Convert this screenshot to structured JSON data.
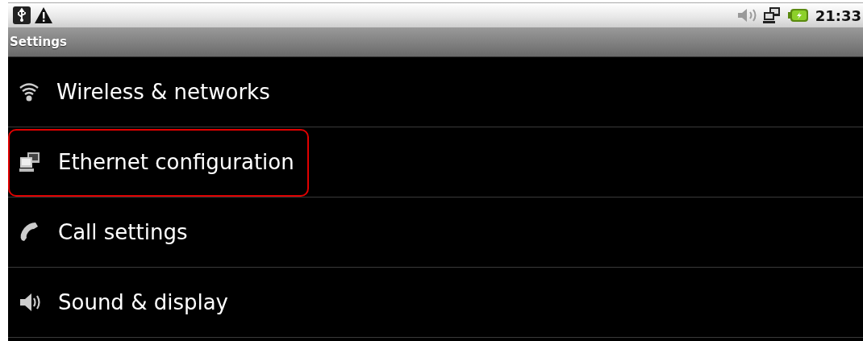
{
  "status_bar": {
    "time": "21:33"
  },
  "title_bar": {
    "title": "Settings"
  },
  "items": [
    {
      "label": "Wireless & networks",
      "kind": "wifi",
      "highlighted": false
    },
    {
      "label": "Ethernet configuration",
      "kind": "ethernet",
      "highlighted": true
    },
    {
      "label": "Call settings",
      "kind": "phone",
      "highlighted": false
    },
    {
      "label": "Sound & display",
      "kind": "speaker",
      "highlighted": false
    }
  ]
}
